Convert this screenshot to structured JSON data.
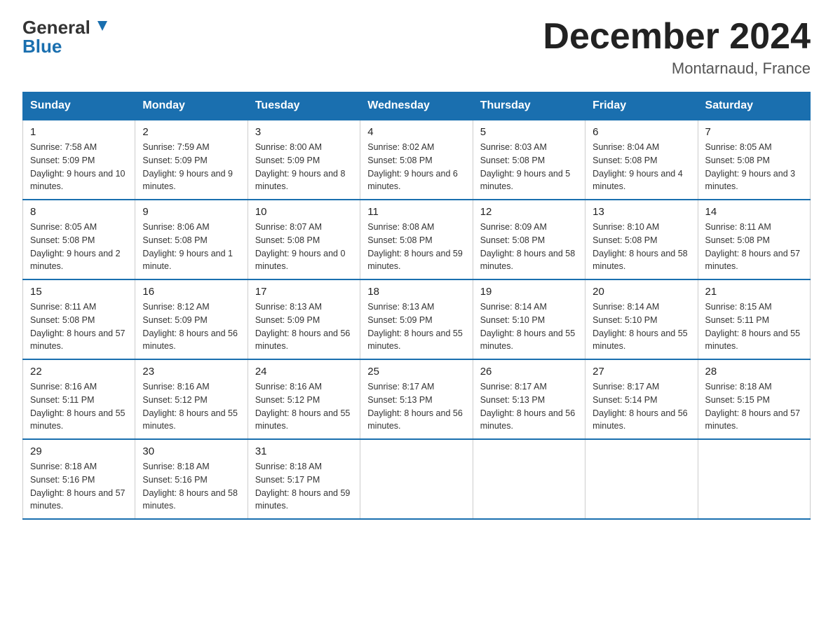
{
  "header": {
    "logo_line1": "General",
    "logo_line2": "Blue",
    "month_title": "December 2024",
    "location": "Montarnaud, France"
  },
  "weekdays": [
    "Sunday",
    "Monday",
    "Tuesday",
    "Wednesday",
    "Thursday",
    "Friday",
    "Saturday"
  ],
  "weeks": [
    [
      {
        "day": "1",
        "sunrise": "7:58 AM",
        "sunset": "5:09 PM",
        "daylight": "9 hours and 10 minutes."
      },
      {
        "day": "2",
        "sunrise": "7:59 AM",
        "sunset": "5:09 PM",
        "daylight": "9 hours and 9 minutes."
      },
      {
        "day": "3",
        "sunrise": "8:00 AM",
        "sunset": "5:09 PM",
        "daylight": "9 hours and 8 minutes."
      },
      {
        "day": "4",
        "sunrise": "8:02 AM",
        "sunset": "5:08 PM",
        "daylight": "9 hours and 6 minutes."
      },
      {
        "day": "5",
        "sunrise": "8:03 AM",
        "sunset": "5:08 PM",
        "daylight": "9 hours and 5 minutes."
      },
      {
        "day": "6",
        "sunrise": "8:04 AM",
        "sunset": "5:08 PM",
        "daylight": "9 hours and 4 minutes."
      },
      {
        "day": "7",
        "sunrise": "8:05 AM",
        "sunset": "5:08 PM",
        "daylight": "9 hours and 3 minutes."
      }
    ],
    [
      {
        "day": "8",
        "sunrise": "8:05 AM",
        "sunset": "5:08 PM",
        "daylight": "9 hours and 2 minutes."
      },
      {
        "day": "9",
        "sunrise": "8:06 AM",
        "sunset": "5:08 PM",
        "daylight": "9 hours and 1 minute."
      },
      {
        "day": "10",
        "sunrise": "8:07 AM",
        "sunset": "5:08 PM",
        "daylight": "9 hours and 0 minutes."
      },
      {
        "day": "11",
        "sunrise": "8:08 AM",
        "sunset": "5:08 PM",
        "daylight": "8 hours and 59 minutes."
      },
      {
        "day": "12",
        "sunrise": "8:09 AM",
        "sunset": "5:08 PM",
        "daylight": "8 hours and 58 minutes."
      },
      {
        "day": "13",
        "sunrise": "8:10 AM",
        "sunset": "5:08 PM",
        "daylight": "8 hours and 58 minutes."
      },
      {
        "day": "14",
        "sunrise": "8:11 AM",
        "sunset": "5:08 PM",
        "daylight": "8 hours and 57 minutes."
      }
    ],
    [
      {
        "day": "15",
        "sunrise": "8:11 AM",
        "sunset": "5:08 PM",
        "daylight": "8 hours and 57 minutes."
      },
      {
        "day": "16",
        "sunrise": "8:12 AM",
        "sunset": "5:09 PM",
        "daylight": "8 hours and 56 minutes."
      },
      {
        "day": "17",
        "sunrise": "8:13 AM",
        "sunset": "5:09 PM",
        "daylight": "8 hours and 56 minutes."
      },
      {
        "day": "18",
        "sunrise": "8:13 AM",
        "sunset": "5:09 PM",
        "daylight": "8 hours and 55 minutes."
      },
      {
        "day": "19",
        "sunrise": "8:14 AM",
        "sunset": "5:10 PM",
        "daylight": "8 hours and 55 minutes."
      },
      {
        "day": "20",
        "sunrise": "8:14 AM",
        "sunset": "5:10 PM",
        "daylight": "8 hours and 55 minutes."
      },
      {
        "day": "21",
        "sunrise": "8:15 AM",
        "sunset": "5:11 PM",
        "daylight": "8 hours and 55 minutes."
      }
    ],
    [
      {
        "day": "22",
        "sunrise": "8:16 AM",
        "sunset": "5:11 PM",
        "daylight": "8 hours and 55 minutes."
      },
      {
        "day": "23",
        "sunrise": "8:16 AM",
        "sunset": "5:12 PM",
        "daylight": "8 hours and 55 minutes."
      },
      {
        "day": "24",
        "sunrise": "8:16 AM",
        "sunset": "5:12 PM",
        "daylight": "8 hours and 55 minutes."
      },
      {
        "day": "25",
        "sunrise": "8:17 AM",
        "sunset": "5:13 PM",
        "daylight": "8 hours and 56 minutes."
      },
      {
        "day": "26",
        "sunrise": "8:17 AM",
        "sunset": "5:13 PM",
        "daylight": "8 hours and 56 minutes."
      },
      {
        "day": "27",
        "sunrise": "8:17 AM",
        "sunset": "5:14 PM",
        "daylight": "8 hours and 56 minutes."
      },
      {
        "day": "28",
        "sunrise": "8:18 AM",
        "sunset": "5:15 PM",
        "daylight": "8 hours and 57 minutes."
      }
    ],
    [
      {
        "day": "29",
        "sunrise": "8:18 AM",
        "sunset": "5:16 PM",
        "daylight": "8 hours and 57 minutes."
      },
      {
        "day": "30",
        "sunrise": "8:18 AM",
        "sunset": "5:16 PM",
        "daylight": "8 hours and 58 minutes."
      },
      {
        "day": "31",
        "sunrise": "8:18 AM",
        "sunset": "5:17 PM",
        "daylight": "8 hours and 59 minutes."
      },
      null,
      null,
      null,
      null
    ]
  ],
  "labels": {
    "sunrise": "Sunrise:",
    "sunset": "Sunset:",
    "daylight": "Daylight:"
  }
}
